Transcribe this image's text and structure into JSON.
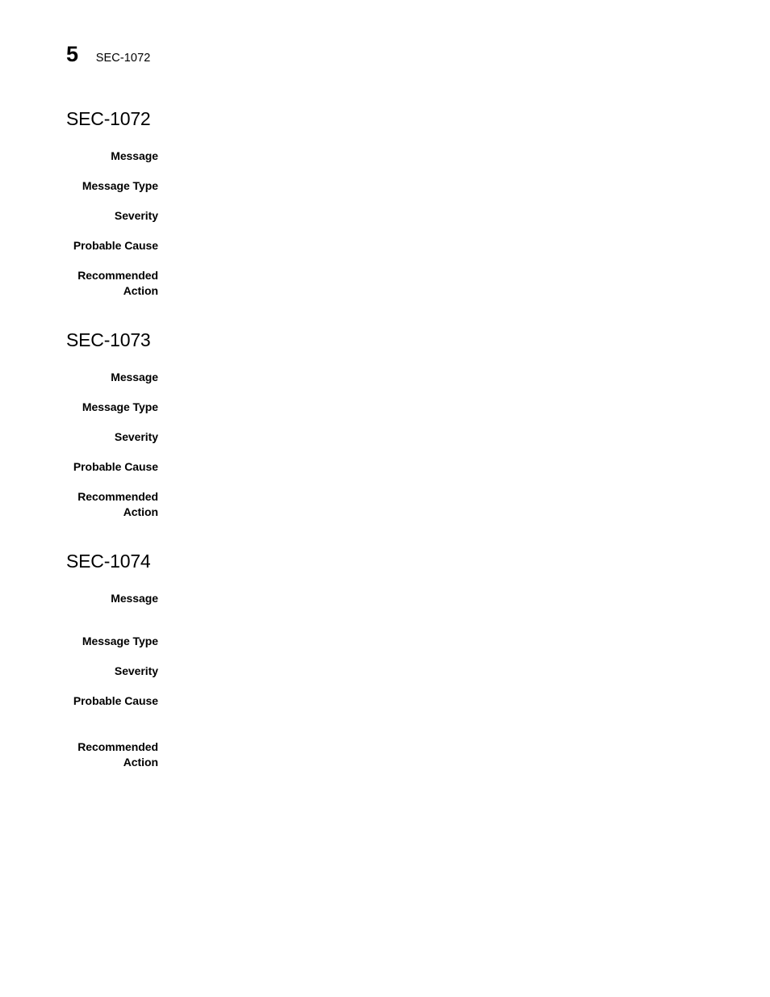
{
  "header": {
    "page_number": "5",
    "title": "SEC-1072"
  },
  "labels": {
    "message": "Message",
    "message_type": "Message Type",
    "severity": "Severity",
    "probable_cause": "Probable Cause",
    "recommended_action": "Recommended\nAction"
  },
  "sections": [
    {
      "heading": "SEC-1072",
      "fields": {
        "message": "",
        "message_type": "",
        "severity": "",
        "probable_cause": "",
        "recommended_action": ""
      }
    },
    {
      "heading": "SEC-1073",
      "fields": {
        "message": "",
        "message_type": "",
        "severity": "",
        "probable_cause": "",
        "recommended_action": ""
      }
    },
    {
      "heading": "SEC-1074",
      "fields": {
        "message": "",
        "message_type": "",
        "severity": "",
        "probable_cause": "",
        "recommended_action": ""
      }
    }
  ]
}
